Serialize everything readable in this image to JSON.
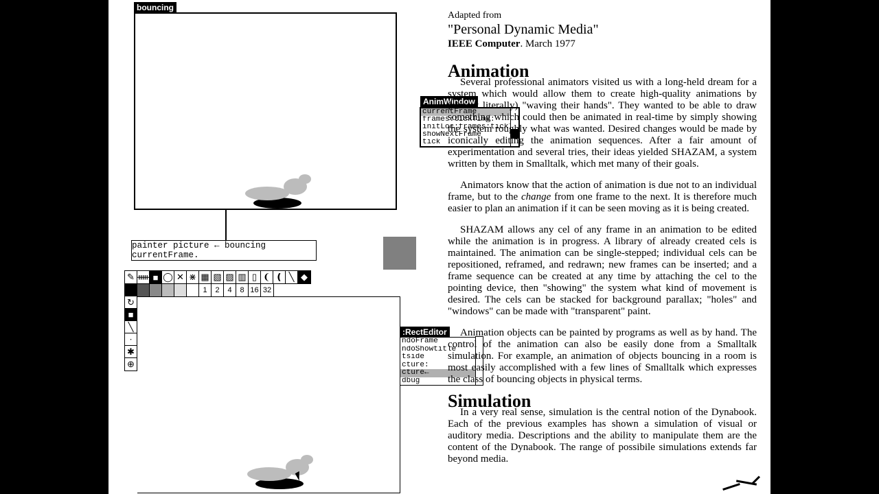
{
  "windows": {
    "bouncing": {
      "title": "bouncing"
    },
    "anim": {
      "title": "AnimWindow",
      "items": [
        {
          "label": "currentFrame",
          "selected": true
        },
        {
          "label": "frames:tickTime:",
          "selected": false
        },
        {
          "label": "initLoc:frames:tickTim",
          "selected": false
        },
        {
          "label": "showNextFrame",
          "selected": false
        },
        {
          "label": "tick",
          "selected": false
        }
      ]
    },
    "rect": {
      "title": ":RectEditor",
      "items": [
        {
          "label": "ndoFrame",
          "selected": false
        },
        {
          "label": "ndoShowtitle",
          "selected": false
        },
        {
          "label": "tside",
          "selected": false
        },
        {
          "label": "cture:",
          "selected": false
        },
        {
          "label": "cture←",
          "selected": true
        },
        {
          "label": "dbug",
          "selected": false
        }
      ]
    }
  },
  "codebox": {
    "text": "painter picture ← bouncing currentFrame."
  },
  "painter": {
    "tools": [
      "✎",
      "ᚔ",
      "■",
      "◯",
      "✕",
      "⋇",
      "▦",
      "▧",
      "▨",
      "▥",
      "▯",
      "❨",
      "❪",
      "╲",
      "◆"
    ],
    "swatch_colors": [
      "#000",
      "#555",
      "#888",
      "#bbb",
      "#ddd",
      "#fff"
    ],
    "swatch_numbers": [
      "1",
      "2",
      "4",
      "8",
      "16",
      "32"
    ],
    "vtools": [
      "↻",
      "■",
      "╲",
      "·",
      "✱",
      "⊕"
    ]
  },
  "text": {
    "adapted": "Adapted from",
    "title": "\"Personal Dynamic Media\"",
    "journal_bold": "IEEE Computer",
    "journal_rest": ". March 1977",
    "h_animation": "Animation",
    "p1": "Several professional animators visited us with a long-held dream for a system which would allow them to create high-quality animations by (almost literally) \"waving their hands\". They wanted to be able to draw something which could then be animated in real-time by simply showing the system roughly what was wanted. Desired changes would be made by iconically editing the animation sequences. After a fair amount of experimentation and several tries, their ideas yielded SHAZAM, a system written by them in Smalltalk, which met many of their goals.",
    "p2a": "Animators know that the action of animation is due not to an individual frame, but to the ",
    "p2_ital": "change",
    "p2b": " from one frame to the next. It is therefore much easier to plan an animation if it can be seen moving as it is being created.",
    "p3": "SHAZAM allows any cel of any frame in an animation to be edited while the animation is in progress. A library of already created cels is maintained. The animation can be single-stepped; individual cels can be repositioned, reframed, and redrawn; new frames can be inserted; and a frame sequence can be created at any time by attaching the cel to the pointing device, then \"showing\" the system what kind of movement is desired. The cels can be stacked for background parallax; \"holes\" and \"windows\" can be made with \"transparent\" paint.",
    "p4": "Animation objects can be painted by programs as well as by hand. The control of the animation can also be easily done from a Smalltalk simulation. For example, an animation of objects bouncing in a room is most easily accomplished with a few lines of Smalltalk which expresses the class of bouncing objects in physical terms.",
    "h_simulation": "Simulation",
    "p5": "In a very real sense, simulation is the central notion of the Dynabook. Each of the previous examples has shown a simulation of visual or auditory media. Descriptions and the ability to manipulate them are the content of the Dynabook. The range of possibile simulations extends far beyond media."
  }
}
